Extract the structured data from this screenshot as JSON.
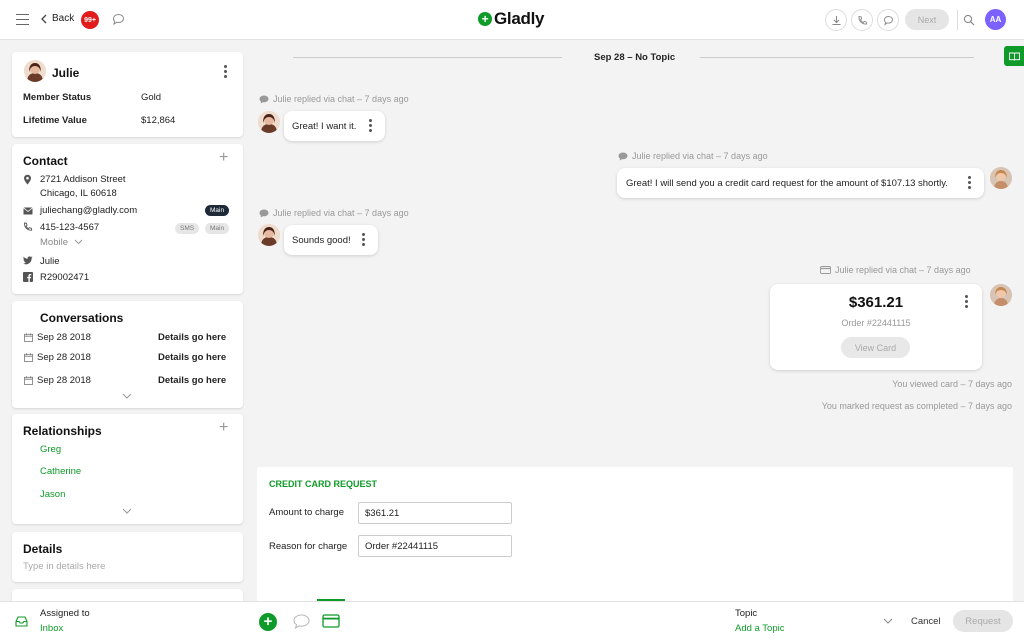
{
  "topbar": {
    "back_label": "Back",
    "notification_count": "99+",
    "brand": "Gladly",
    "next_label": "Next",
    "user_initials": "AA"
  },
  "customer": {
    "name": "Julie",
    "member_status_label": "Member Status",
    "member_status_value": "Gold",
    "lifetime_value_label": "Lifetime Value",
    "lifetime_value_value": "$12,864"
  },
  "contact": {
    "title": "Contact",
    "address_line1": "2721 Addison Street",
    "address_line2": "Chicago, IL 60618",
    "email": "juliechang@gladly.com",
    "email_tag": "Main",
    "phone": "415-123-4567",
    "phone_tags": [
      "SMS",
      "Main"
    ],
    "phone_type": "Mobile",
    "twitter": "Julie",
    "facebook": "R29002471"
  },
  "conversations": {
    "title": "Conversations",
    "items": [
      {
        "date": "Sep 28 2018",
        "details": "Details go here"
      },
      {
        "date": "Sep 28 2018",
        "details": "Details go here"
      },
      {
        "date": "Sep 28 2018",
        "details": "Details go here"
      }
    ]
  },
  "relationships": {
    "title": "Relationships",
    "items": [
      "Greg",
      "Catherine",
      "Jason"
    ]
  },
  "details": {
    "title": "Details",
    "placeholder": "Type in details here"
  },
  "assigned": {
    "label": "Assigned to",
    "value": "Inbox"
  },
  "chat": {
    "divider_label": "Sep 28 – No Topic",
    "messages": [
      {
        "meta": "Julie replied via chat – 7 days ago",
        "text": "Great! I want it."
      },
      {
        "meta": "Julie replied via chat – 7 days ago",
        "text": "Great! I will send you a credit card request for the amount of $107.13 shortly."
      },
      {
        "meta": "Julie replied via chat – 7 days ago",
        "text": "Sounds good!"
      },
      {
        "meta": "Julie replied via chat – 7 days ago"
      }
    ],
    "payment_card": {
      "amount": "$361.21",
      "order": "Order #22441115",
      "button": "View Card"
    },
    "status_viewed": "You viewed card – 7 days ago",
    "status_completed": "You marked request as completed – 7 days ago"
  },
  "request_form": {
    "title": "CREDIT CARD REQUEST",
    "amount_label": "Amount to charge",
    "amount_value": "$361.21",
    "reason_label": "Reason for charge",
    "reason_value": "Order #22441115"
  },
  "footer": {
    "topic_label": "Topic",
    "topic_action": "Add a Topic",
    "cancel_label": "Cancel",
    "request_label": "Request"
  },
  "colors": {
    "brand_green": "#0f9b29",
    "badge_red": "#e11a1a",
    "avatar_purple": "#7b61ff"
  }
}
